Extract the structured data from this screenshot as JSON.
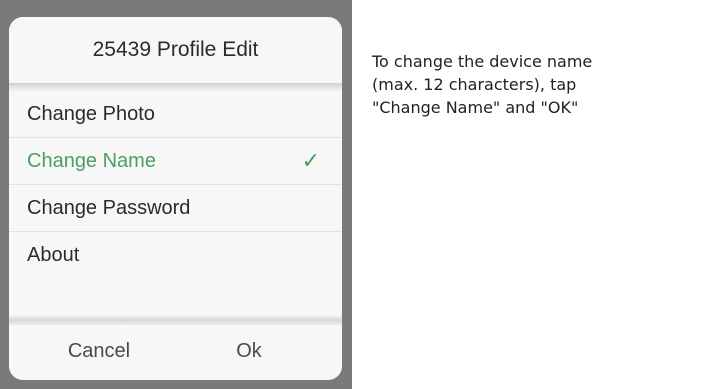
{
  "dialog": {
    "title": "25439 Profile Edit",
    "items": [
      {
        "label": "Change Photo",
        "selected": false
      },
      {
        "label": "Change Name",
        "selected": true
      },
      {
        "label": "Change Password",
        "selected": false
      },
      {
        "label": "About",
        "selected": false
      }
    ],
    "check_mark": "✓",
    "cancel_label": "Cancel",
    "ok_label": "Ok"
  },
  "instruction": {
    "lines": [
      "To change the device name",
      "(max. 12 characters), tap",
      "\"Change Name\" and \"OK\""
    ]
  },
  "colors": {
    "selected": "#4e9d63",
    "backdrop": "#7a7a7a",
    "dialog_bg": "#f7f7f7"
  }
}
